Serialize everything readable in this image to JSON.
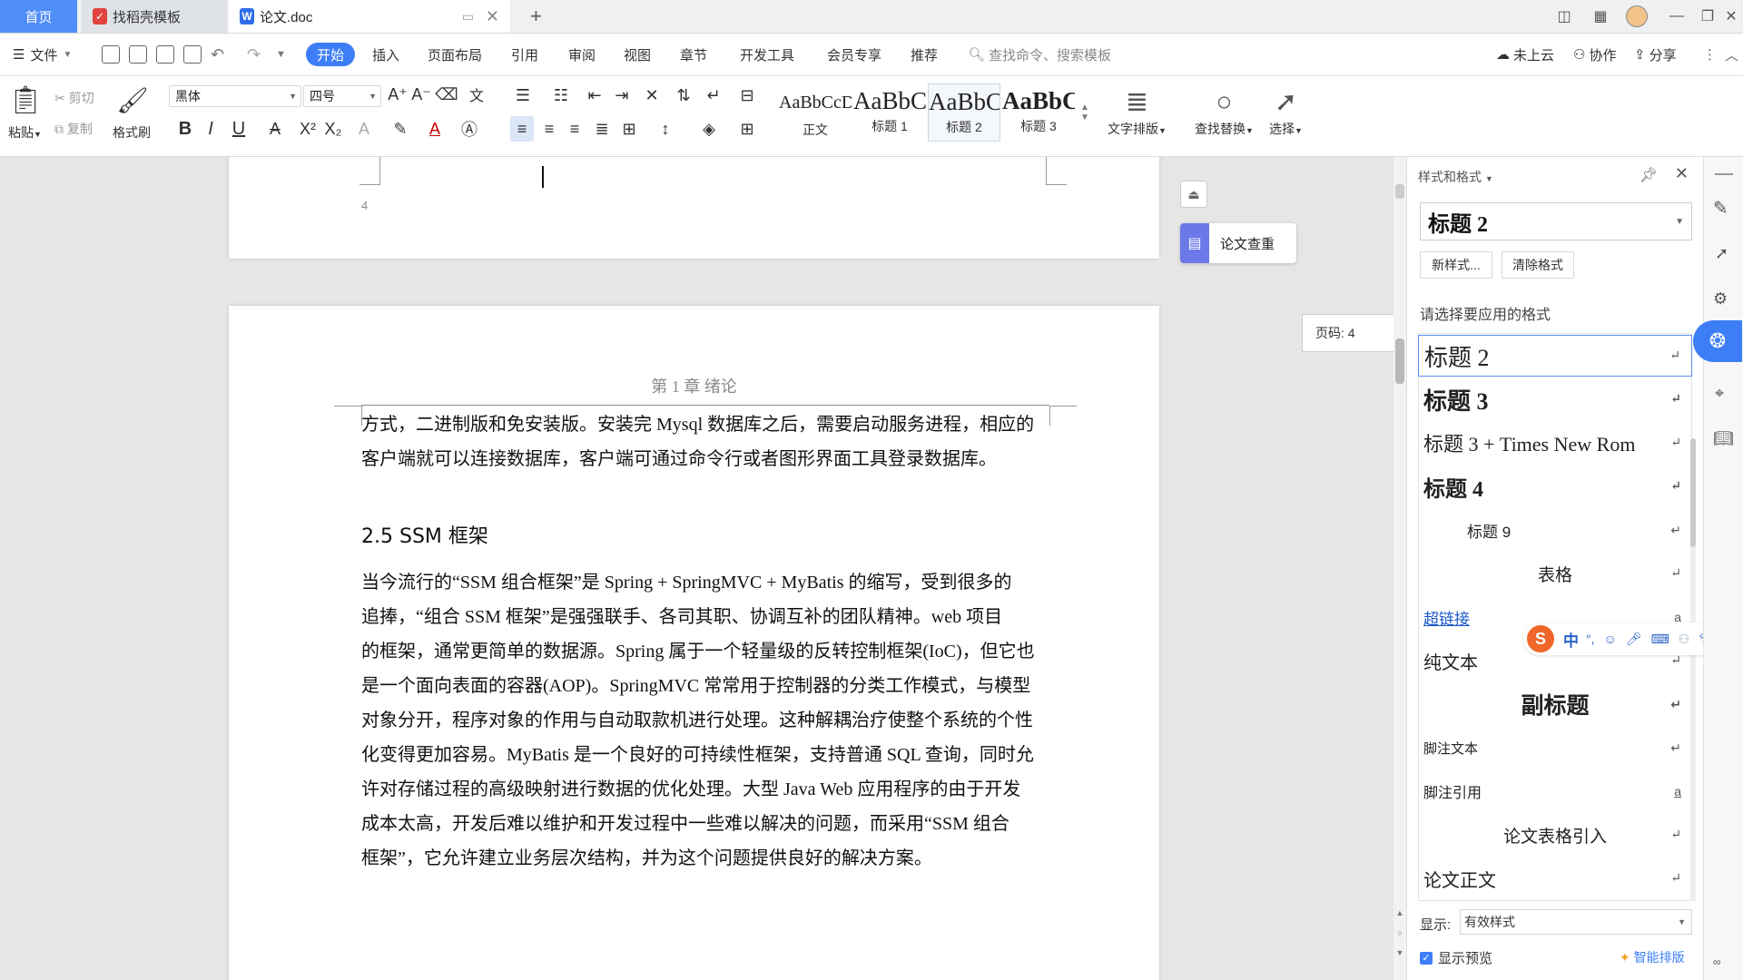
{
  "tabs": {
    "home": "首页",
    "template": "找稻壳模板",
    "doc": "论文.doc",
    "new_tab": "+"
  },
  "menu": {
    "file": "文件",
    "items": [
      "开始",
      "插入",
      "页面布局",
      "引用",
      "审阅",
      "视图",
      "章节",
      "开发工具",
      "会员专享",
      "推荐"
    ],
    "search_placeholder": "查找命令、搜索模板",
    "cloud": "未上云",
    "collab": "协作",
    "share": "分享"
  },
  "ribbon": {
    "paste": "粘贴",
    "cut": "剪切",
    "copy": "复制",
    "format_painter": "格式刷",
    "font_name": "黑体",
    "font_size": "四号",
    "styles": [
      {
        "sample": "AaBbCcDd",
        "name": "正文"
      },
      {
        "sample": "AaBbC",
        "name": "标题 1"
      },
      {
        "sample": "AaBbC",
        "name": "标题 2"
      },
      {
        "sample": "AaBbC",
        "name": "标题 3"
      }
    ],
    "text_layout": "文字排版",
    "find_replace": "查找替换",
    "select": "选择"
  },
  "document": {
    "prev_page_number": "4",
    "header": "第 1 章  绪论",
    "para1": [
      "方式，二进制版和免安装版。安装完 Mysql 数据库之后，需要启动服务进程，相应的",
      "客户端就可以连接数据库，客户端可通过命令行或者图形界面工具登录数据库。"
    ],
    "heading": "2.5  SSM 框架",
    "para2": [
      "当今流行的“SSM 组合框架”是 Spring + SpringMVC + MyBatis 的缩写，受到很多的",
      "追捧，“组合 SSM 框架”是强强联手、各司其职、协调互补的团队精神。web 项目",
      "的框架，通常更简单的数据源。Spring 属于一个轻量级的反转控制框架(IoC)，但它也",
      "是一个面向表面的容器(AOP)。SpringMVC 常常用于控制器的分类工作模式，与模型",
      "对象分开，程序对象的作用与自动取款机进行处理。这种解耦治疗使整个系统的个性",
      "化变得更加容易。MyBatis 是一个良好的可持续性框架，支持普通 SQL 查询，同时允",
      "许对存储过程的高级映射进行数据的优化处理。大型 Java Web 应用程序的由于开发",
      "成本太高，开发后难以维护和开发过程中一些难以解决的问题，而采用“SSM 组合",
      "框架”，它允许建立业务层次结构，并为这个问题提供良好的解决方案。"
    ]
  },
  "floating": {
    "paper_check": "论文查重",
    "page_code": "页码: 4"
  },
  "panel": {
    "title": "样式和格式",
    "current_style": "标题  2",
    "new_style": "新样式...",
    "clear_format": "清除格式",
    "choose_label": "请选择要应用的格式",
    "styles": [
      "标题  2",
      "标题  3",
      "标题  3 + Times New Rom",
      "标题  4",
      "标题 9",
      "表格",
      "超链接",
      "纯文本",
      "副标题",
      "脚注文本",
      "脚注引用",
      "论文表格引入",
      "论文正文"
    ],
    "show_label": "显示:",
    "show_value": "有效样式",
    "preview_label": "显示预览",
    "smart_layout": "智能排版"
  },
  "ime": {
    "mode": "中"
  },
  "colors": {
    "accent": "#3d7ef7",
    "home_tab": "#4f8ef7",
    "link": "#1a56c8"
  }
}
